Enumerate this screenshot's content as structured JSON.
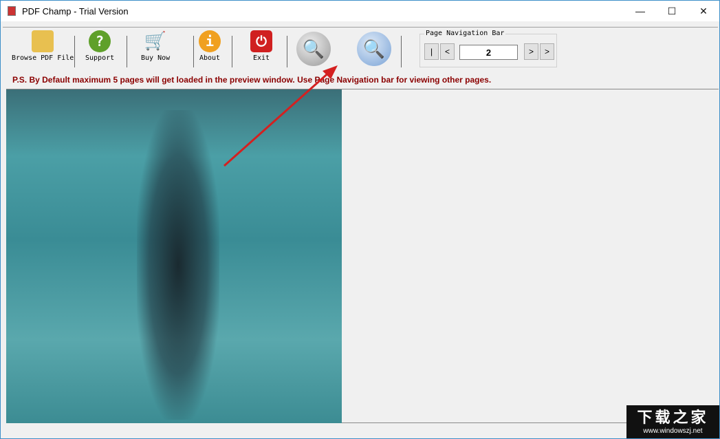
{
  "window": {
    "title": "PDF Champ - Trial Version",
    "minimize": "—",
    "maximize": "☐",
    "close": "✕"
  },
  "toolbar": {
    "browse": "Browse PDF File",
    "support": "Support",
    "buy": "Buy Now",
    "about": "About",
    "exit": "Exit"
  },
  "nav": {
    "label": "Page Navigation Bar",
    "first": "|",
    "prev": "<",
    "page": "2",
    "next": ">",
    "last": ">"
  },
  "notice": "P.S. By Default maximum 5 pages will get loaded in the preview window. Use Page  Navigation bar for viewing other pages.",
  "watermark": {
    "title": "下载之家",
    "url": "www.windowszj.net"
  },
  "colors": {
    "notice": "#8b0000",
    "accent": "#3c8fc8"
  }
}
